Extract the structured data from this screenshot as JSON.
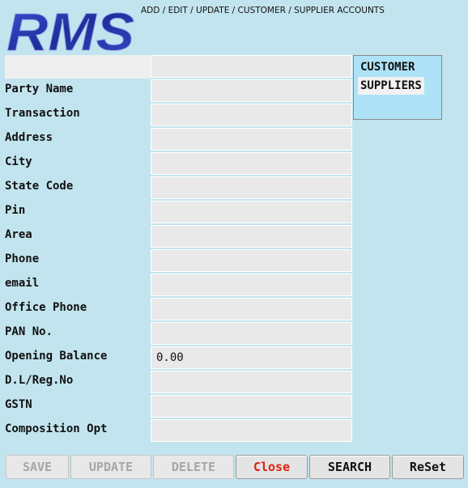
{
  "app": {
    "logo_text": "RMS",
    "window_title": "ADD / EDIT / UPDATE / CUSTOMER / SUPPLIER ACCOUNTS"
  },
  "form": {
    "fields": [
      {
        "label": "Party Name",
        "value": ""
      },
      {
        "label": "Transaction",
        "value": ""
      },
      {
        "label": "Address",
        "value": ""
      },
      {
        "label": "City",
        "value": ""
      },
      {
        "label": "State Code",
        "value": ""
      },
      {
        "label": "Pin",
        "value": ""
      },
      {
        "label": "Area",
        "value": ""
      },
      {
        "label": "Phone",
        "value": ""
      },
      {
        "label": "email",
        "value": ""
      },
      {
        "label": "Office Phone",
        "value": ""
      },
      {
        "label": "PAN No.",
        "value": ""
      },
      {
        "label": "Opening Balance",
        "value": "0.00"
      },
      {
        "label": "D.L/Reg.No",
        "value": ""
      },
      {
        "label": "GSTN",
        "value": ""
      },
      {
        "label": "Composition Opt",
        "value": ""
      }
    ]
  },
  "account_types": {
    "items": [
      "CUSTOMER",
      "SUPPLIERS"
    ],
    "selected": "SUPPLIERS"
  },
  "buttons": {
    "save": "SAVE",
    "update": "UPDATE",
    "delete": "DELETE",
    "close": "Close",
    "search": "SEARCH",
    "reset": "ReSet"
  },
  "colors": {
    "background": "#c2e4ee",
    "logo": "#2a3fb2",
    "list_background": "#aee2f6",
    "close_text": "#e0200f",
    "disabled_text": "#a6a6a6"
  }
}
